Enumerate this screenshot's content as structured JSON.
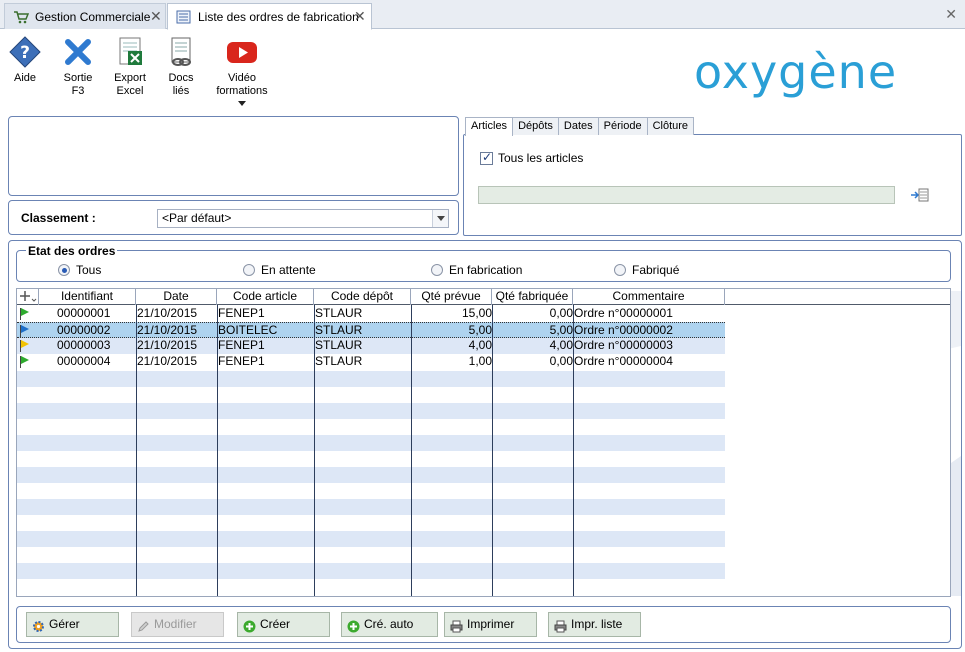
{
  "tabs": [
    {
      "label": "Gestion Commerciale",
      "active": false
    },
    {
      "label": "Liste des ordres de fabrication",
      "active": true
    }
  ],
  "toolbar": {
    "aide": "Aide",
    "sortie_1": "Sortie",
    "sortie_2": "F3",
    "export_1": "Export",
    "export_2": "Excel",
    "docs_1": "Docs",
    "docs_2": "liés",
    "video_1": "Vidéo",
    "video_2": "formations"
  },
  "logo": "oxygène",
  "classement": {
    "label": "Classement :",
    "value": "<Par défaut>"
  },
  "filter_tabs": [
    "Articles",
    "Dépôts",
    "Dates",
    "Période",
    "Clôture"
  ],
  "articles": {
    "checkbox_label": "Tous les articles",
    "checked": true
  },
  "etat": {
    "legend": "Etat des ordres",
    "options": [
      "Tous",
      "En attente",
      "En fabrication",
      "Fabriqué"
    ],
    "selected": "Tous"
  },
  "grid": {
    "columns": [
      "Identifiant",
      "Date",
      "Code article",
      "Code dépôt",
      "Qté prévue",
      "Qté fabriquée",
      "Commentaire"
    ],
    "rows": [
      {
        "status": "green",
        "id": "00000001",
        "date": "21/10/2015",
        "article": "FENEP1",
        "depot": "STLAUR",
        "prevue": "15,00",
        "fabriquee": "0,00",
        "commentaire": "Ordre n°00000001"
      },
      {
        "status": "blue",
        "id": "00000002",
        "date": "21/10/2015",
        "article": "BOITELEC",
        "depot": "STLAUR",
        "prevue": "5,00",
        "fabriquee": "5,00",
        "commentaire": "Ordre n°00000002"
      },
      {
        "status": "yellow",
        "id": "00000003",
        "date": "21/10/2015",
        "article": "FENEP1",
        "depot": "STLAUR",
        "prevue": "4,00",
        "fabriquee": "4,00",
        "commentaire": "Ordre n°00000003"
      },
      {
        "status": "green",
        "id": "00000004",
        "date": "21/10/2015",
        "article": "FENEP1",
        "depot": "STLAUR",
        "prevue": "1,00",
        "fabriquee": "0,00",
        "commentaire": "Ordre n°00000004"
      }
    ]
  },
  "buttons": {
    "gerer": "Gérer",
    "modifier": "Modifier",
    "creer": "Créer",
    "cre_auto": "Cré. auto",
    "imprimer": "Imprimer",
    "impr_liste": "Impr. liste"
  },
  "colors": {
    "accent": "#6b84b4",
    "logo": "#2a9fd6",
    "flag_green": "#2eaa2e",
    "flag_blue": "#1f6fc8",
    "flag_yellow": "#f2c200"
  }
}
